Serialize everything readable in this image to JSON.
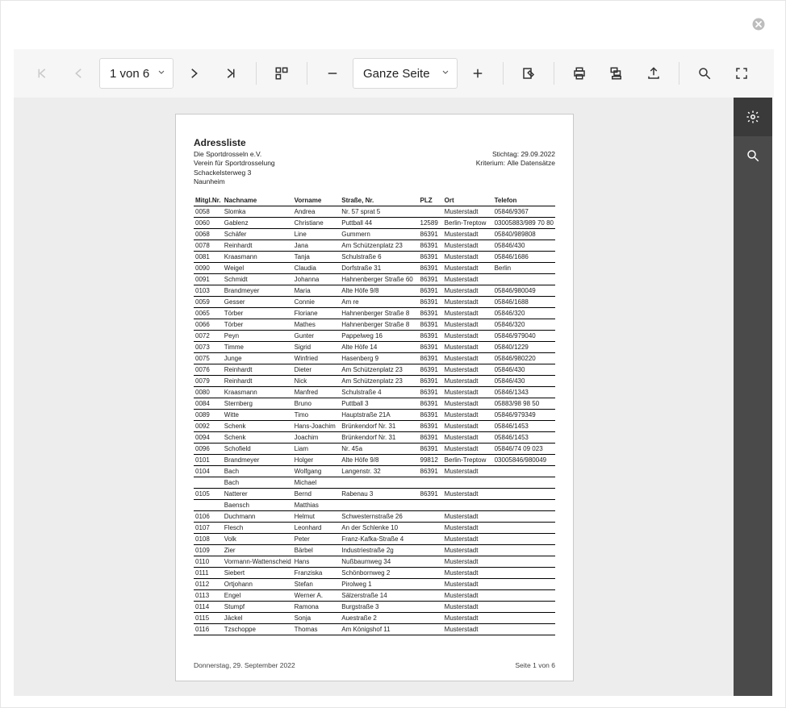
{
  "toolbar": {
    "page_display": "1 von 6",
    "zoom_display": "Ganze Seite"
  },
  "report": {
    "title": "Adressliste",
    "org": "Die Sportdrosseln e.V.",
    "org2": "Verein für Sportdrosselung",
    "addr": "Schackelsterweg 3",
    "city": "Naunheim",
    "stichtag_label": "Stichtag:",
    "stichtag": "29.09.2022",
    "kriterium_label": "Kriterium:",
    "kriterium": "Alle Datensätze",
    "columns": {
      "mgl": "Mitgl.Nr.",
      "nach": "Nachname",
      "vor": "Vorname",
      "str": "Straße, Nr.",
      "plz": "PLZ",
      "ort": "Ort",
      "tel": "Telefon"
    },
    "footer_left": "Donnerstag, 29. September 2022",
    "footer_right": "Seite 1 von 6",
    "rows": [
      {
        "mgl": "0058",
        "nach": "Slomka",
        "vor": "Andrea",
        "str": "Nr. 57 sprat 5",
        "plz": "",
        "ort": "Musterstadt",
        "tel": "05846/9367"
      },
      {
        "mgl": "0060",
        "nach": "Gablenz",
        "vor": "Christiane",
        "str": "Puttball 44",
        "plz": "12589",
        "ort": "Berlin-Treptow",
        "tel": "03005883/989 70 80"
      },
      {
        "mgl": "0068",
        "nach": "Schäfer",
        "vor": "Line",
        "str": "Gummern",
        "plz": "86391",
        "ort": "Musterstadt",
        "tel": "05840/989808"
      },
      {
        "mgl": "0078",
        "nach": "Reinhardt",
        "vor": "Jana",
        "str": "Am Schützenplatz 23",
        "plz": "86391",
        "ort": "Musterstadt",
        "tel": "05846/430"
      },
      {
        "mgl": "0081",
        "nach": "Kraasmann",
        "vor": "Tanja",
        "str": "Schulstraße 6",
        "plz": "86391",
        "ort": "Musterstadt",
        "tel": "05846/1686"
      },
      {
        "mgl": "0090",
        "nach": "Weigel",
        "vor": "Claudia",
        "str": "Dorfstraße 31",
        "plz": "86391",
        "ort": "Musterstadt",
        "tel": "Berlin"
      },
      {
        "mgl": "0091",
        "nach": "Schmidt",
        "vor": "Johanna",
        "str": "Hahnenberger Straße 60",
        "plz": "86391",
        "ort": "Musterstadt",
        "tel": ""
      },
      {
        "mgl": "0103",
        "nach": "Brandmeyer",
        "vor": "Maria",
        "str": "Alte Höfe 9/8",
        "plz": "86391",
        "ort": "Musterstadt",
        "tel": "05846/980049"
      },
      {
        "mgl": "0059",
        "nach": "Gesser",
        "vor": "Connie",
        "str": "Am re",
        "plz": "86391",
        "ort": "Musterstadt",
        "tel": "05846/1688"
      },
      {
        "mgl": "0065",
        "nach": "Törber",
        "vor": "Floriane",
        "str": "Hahnenberger Straße 8",
        "plz": "86391",
        "ort": "Musterstadt",
        "tel": "05846/320"
      },
      {
        "mgl": "0066",
        "nach": "Törber",
        "vor": "Mathes",
        "str": "Hahnenberger Straße 8",
        "plz": "86391",
        "ort": "Musterstadt",
        "tel": "05846/320"
      },
      {
        "mgl": "0072",
        "nach": "Peyn",
        "vor": "Gunter",
        "str": "Pappelweg 16",
        "plz": "86391",
        "ort": "Musterstadt",
        "tel": "05846/979040"
      },
      {
        "mgl": "0073",
        "nach": "Timme",
        "vor": "Sigrid",
        "str": "Alte Höfe 14",
        "plz": "86391",
        "ort": "Musterstadt",
        "tel": "05840/1229"
      },
      {
        "mgl": "0075",
        "nach": "Junge",
        "vor": "Winfried",
        "str": "Hasenberg 9",
        "plz": "86391",
        "ort": "Musterstadt",
        "tel": "05846/980220"
      },
      {
        "mgl": "0076",
        "nach": "Reinhardt",
        "vor": "Dieter",
        "str": "Am Schützenplatz 23",
        "plz": "86391",
        "ort": "Musterstadt",
        "tel": "05846/430"
      },
      {
        "mgl": "0079",
        "nach": "Reinhardt",
        "vor": "Nick",
        "str": "Am Schützenplatz 23",
        "plz": "86391",
        "ort": "Musterstadt",
        "tel": "05846/430"
      },
      {
        "mgl": "0080",
        "nach": "Kraasmann",
        "vor": "Manfred",
        "str": "Schulstraße 4",
        "plz": "86391",
        "ort": "Musterstadt",
        "tel": "05846/1343"
      },
      {
        "mgl": "0084",
        "nach": "Sternberg",
        "vor": "Bruno",
        "str": "Puttball 3",
        "plz": "86391",
        "ort": "Musterstadt",
        "tel": "05883/98 98 50"
      },
      {
        "mgl": "0089",
        "nach": "Witte",
        "vor": "Timo",
        "str": "Hauptstraße 21A",
        "plz": "86391",
        "ort": "Musterstadt",
        "tel": "05846/979349"
      },
      {
        "mgl": "0092",
        "nach": "Schenk",
        "vor": "Hans-Joachim",
        "str": "Brünkendorf Nr. 31",
        "plz": "86391",
        "ort": "Musterstadt",
        "tel": "05846/1453"
      },
      {
        "mgl": "0094",
        "nach": "Schenk",
        "vor": "Joachim",
        "str": "Brünkendorf Nr. 31",
        "plz": "86391",
        "ort": "Musterstadt",
        "tel": "05846/1453"
      },
      {
        "mgl": "0096",
        "nach": "Schofield",
        "vor": "Liam",
        "str": "Nr. 45a",
        "plz": "86391",
        "ort": "Musterstadt",
        "tel": "05846/74 09 023"
      },
      {
        "mgl": "0101",
        "nach": "Brandmeyer",
        "vor": "Holger",
        "str": "Alte Höfe 9/8",
        "plz": "99812",
        "ort": "Berlin-Treptow",
        "tel": "03005846/980049"
      },
      {
        "mgl": "0104",
        "nach": "Bach",
        "vor": "Wolfgang",
        "str": "Langenstr. 32",
        "plz": "86391",
        "ort": "Musterstadt",
        "tel": ""
      },
      {
        "mgl": "",
        "nach": "Bach",
        "vor": "Michael",
        "str": "",
        "plz": "",
        "ort": "",
        "tel": ""
      },
      {
        "mgl": "0105",
        "nach": "Natterer",
        "vor": "Bernd",
        "str": "Rabenau 3",
        "plz": "86391",
        "ort": "Musterstadt",
        "tel": ""
      },
      {
        "mgl": "",
        "nach": "Baensch",
        "vor": "Matthias",
        "str": "",
        "plz": "",
        "ort": "",
        "tel": ""
      },
      {
        "mgl": "0106",
        "nach": "Duchmann",
        "vor": "Helmut",
        "str": "Schwesternstraße 26",
        "plz": "",
        "ort": "Musterstadt",
        "tel": ""
      },
      {
        "mgl": "0107",
        "nach": "Flesch",
        "vor": "Leonhard",
        "str": "An der Schlenke 10",
        "plz": "",
        "ort": "Musterstadt",
        "tel": ""
      },
      {
        "mgl": "0108",
        "nach": "Volk",
        "vor": "Peter",
        "str": "Franz-Kafka-Straße 4",
        "plz": "",
        "ort": "Musterstadt",
        "tel": ""
      },
      {
        "mgl": "0109",
        "nach": "Zier",
        "vor": "Bärbel",
        "str": "Industriestraße 2g",
        "plz": "",
        "ort": "Musterstadt",
        "tel": ""
      },
      {
        "mgl": "0110",
        "nach": "Vormann-Wattenscheid",
        "vor": "Hans",
        "str": "Nußbaumweg 34",
        "plz": "",
        "ort": "Musterstadt",
        "tel": ""
      },
      {
        "mgl": "0111",
        "nach": "Siebert",
        "vor": "Franziska",
        "str": "Schönbornweg 2",
        "plz": "",
        "ort": "Musterstadt",
        "tel": ""
      },
      {
        "mgl": "0112",
        "nach": "Ortjohann",
        "vor": "Stefan",
        "str": "Pirolweg 1",
        "plz": "",
        "ort": "Musterstadt",
        "tel": ""
      },
      {
        "mgl": "0113",
        "nach": "Engel",
        "vor": "Werner A.",
        "str": "Sälzerstraße 14",
        "plz": "",
        "ort": "Musterstadt",
        "tel": ""
      },
      {
        "mgl": "0114",
        "nach": "Stumpf",
        "vor": "Ramona",
        "str": "Burgstraße 3",
        "plz": "",
        "ort": "Musterstadt",
        "tel": ""
      },
      {
        "mgl": "0115",
        "nach": "Jäckel",
        "vor": "Sonja",
        "str": "Auestraße 2",
        "plz": "",
        "ort": "Musterstadt",
        "tel": ""
      },
      {
        "mgl": "0116",
        "nach": "Tzschoppe",
        "vor": "Thomas",
        "str": "Am Königshof 11",
        "plz": "",
        "ort": "Musterstadt",
        "tel": ""
      }
    ]
  }
}
